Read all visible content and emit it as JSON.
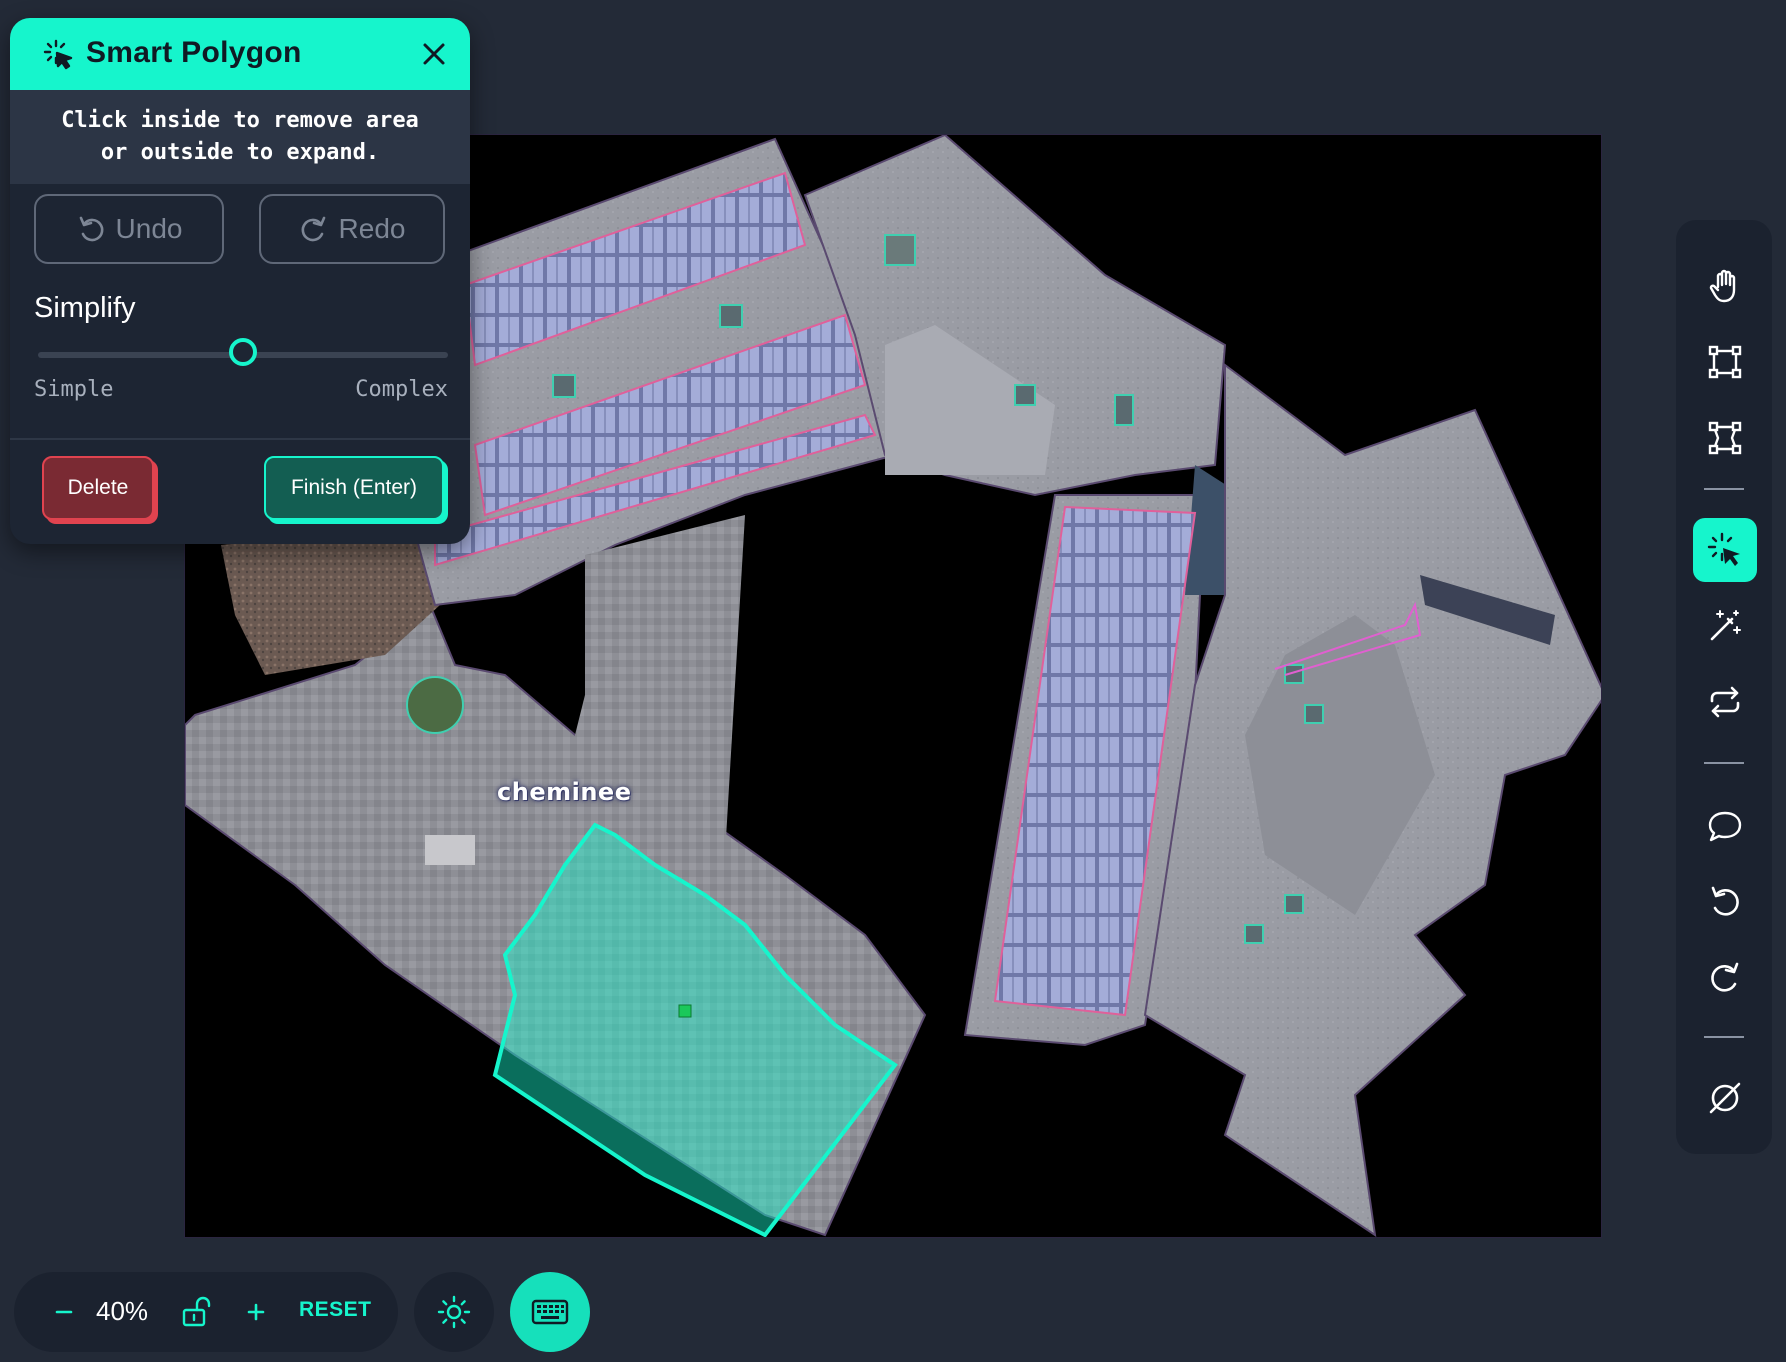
{
  "panel": {
    "title": "Smart Polygon",
    "hint_line1": "Click inside to remove area",
    "hint_line2": "or outside to expand.",
    "undo_label": "Undo",
    "redo_label": "Redo",
    "simplify_label": "Simplify",
    "simplify_min_label": "Simple",
    "simplify_max_label": "Complex",
    "simplify_value": 0.5,
    "delete_label": "Delete",
    "finish_label": "Finish (Enter)"
  },
  "canvas": {
    "annotation_label": "cheminee"
  },
  "toolbar": {
    "tools": [
      "hand-icon",
      "bounding-box-icon",
      "polygon-icon",
      "smart-polygon-icon",
      "magic-wand-icon",
      "convert-icon",
      "comment-icon",
      "undo-icon",
      "redo-icon",
      "hide-annotations-icon"
    ],
    "active_tool": "smart-polygon-icon"
  },
  "zoom": {
    "value": "40%",
    "reset_label": "RESET"
  },
  "colors": {
    "accent": "#16f5cc",
    "background": "#232a37",
    "panel": "#1d2533",
    "danger": "#e0434f",
    "solar_outline": "#e0609a"
  }
}
